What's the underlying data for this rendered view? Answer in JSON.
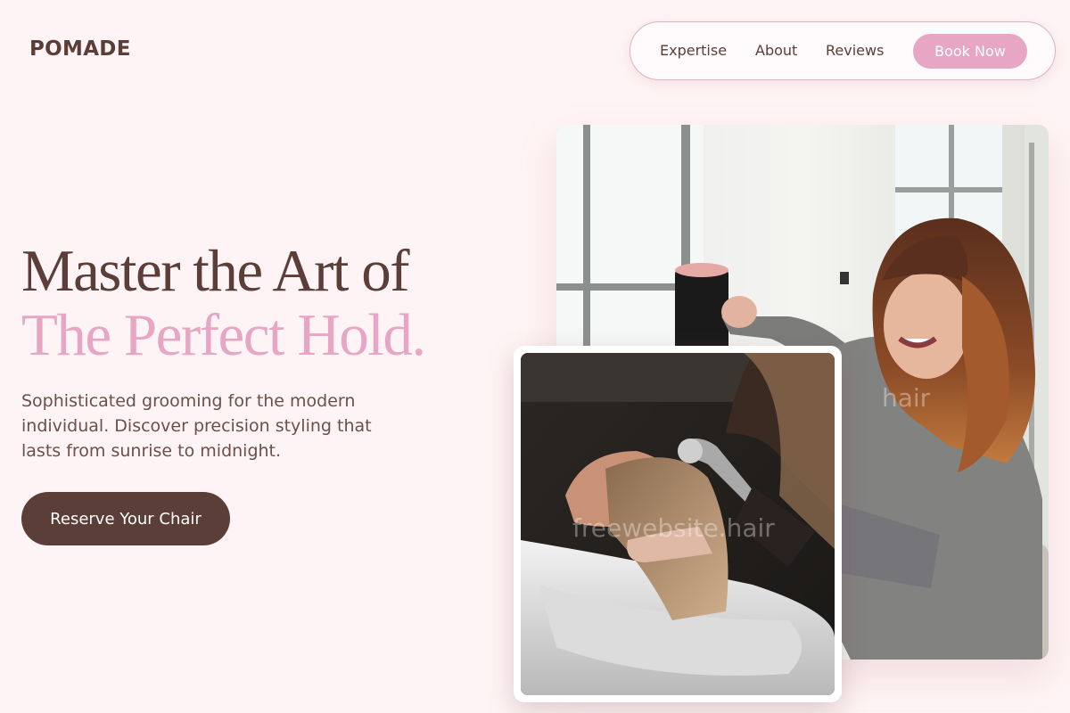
{
  "brand": {
    "logo": "POMADE"
  },
  "nav": {
    "links": [
      "Expertise",
      "About",
      "Reviews"
    ],
    "book_label": "Book Now"
  },
  "hero": {
    "title_line1": "Master the Art of",
    "title_line2": "The Perfect Hold.",
    "subtitle": "Sophisticated grooming for the modern individual. Discover precision styling that lasts from sunrise to midnight.",
    "cta_label": "Reserve Your Chair"
  },
  "images": {
    "main_alt": "Smiling stylist blow-drying hair in a bright salon",
    "secondary_alt": "Client getting hair washed at a salon basin",
    "watermark_main": "hair",
    "watermark_secondary": "freewebsite.hair"
  },
  "colors": {
    "background": "#fff4f5",
    "brown": "#5a3e37",
    "pink": "#e7a6c4"
  }
}
